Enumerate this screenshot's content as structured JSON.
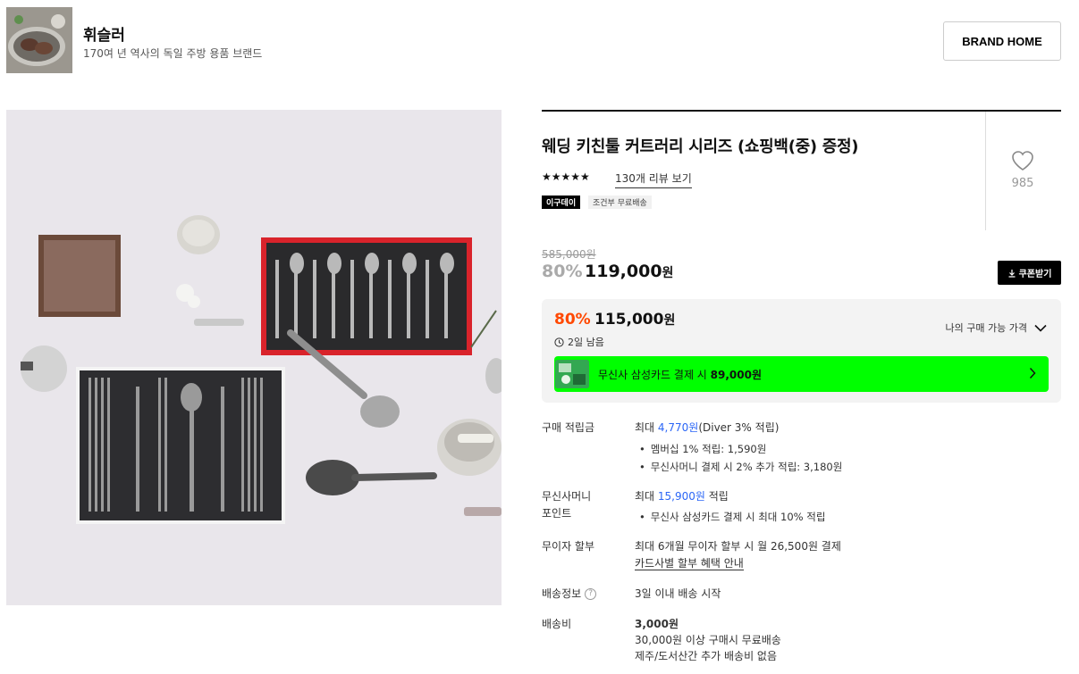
{
  "brand": {
    "name": "휘슬러",
    "description": "170여 년 역사의 독일 주방 용품 브랜드",
    "home_button": "BRAND HOME"
  },
  "product": {
    "title": "웨딩 키친툴 커트러리 시리즈 (쇼핑백(중) 증정)",
    "stars": "★★★★★",
    "review_link": "130개 리뷰 보기",
    "tags": [
      "이구데이",
      "조건부 무료배송"
    ],
    "like_count": "985",
    "original_price": "585,000원",
    "discount_percent": "80%",
    "sale_price": "119,000",
    "won": "원",
    "coupon_button": "쿠폰받기"
  },
  "my_price": {
    "percent": "80%",
    "price": "115,000",
    "won": "원",
    "time_left": "2일 남음",
    "toggle_label": "나의 구매 가능 가격",
    "card_banner_prefix": "무신사 삼성카드 결제 시 ",
    "card_banner_price": "89,000원"
  },
  "benefits": {
    "points_label": "구매 적립금",
    "points_prefix": "최대 ",
    "points_amount": "4,770원",
    "points_suffix": "(Diver 3% 적립)",
    "points_bullets": [
      "멤버십 1% 적립: 1,590원",
      "무신사머니 결제 시 2% 추가 적립: 3,180원"
    ],
    "money_label_1": "무신사머니",
    "money_label_2": "포인트",
    "money_prefix": "최대 ",
    "money_amount": "15,900원",
    "money_suffix": " 적립",
    "money_bullets": [
      "무신사 삼성카드 결제 시 최대 10% 적립"
    ],
    "installment_label": "무이자 할부",
    "installment_text": "최대 6개월 무이자 할부 시 월 26,500원 결제",
    "installment_link": "카드사별 할부 혜택 안내",
    "shipping_info_label": "배송정보",
    "shipping_info_text": "3일 이내 배송 시작",
    "shipping_fee_label": "배송비",
    "shipping_fee_amount": "3,000원",
    "shipping_fee_line2": "30,000원 이상 구매시 무료배송",
    "shipping_fee_line3": "제주/도서산간 추가 배송비 없음"
  },
  "colors": {
    "accent_orange": "#ff4800",
    "card_green": "#00ff00",
    "link_blue": "#2b66f6"
  }
}
